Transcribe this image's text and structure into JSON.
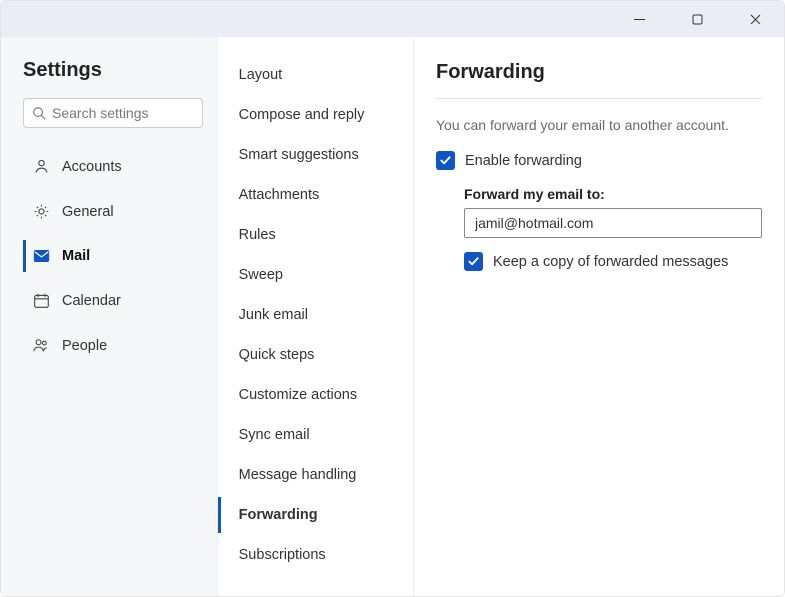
{
  "titlebar": {},
  "settings": {
    "title": "Settings",
    "search_placeholder": "Search settings",
    "nav": {
      "accounts": "Accounts",
      "general": "General",
      "mail": "Mail",
      "calendar": "Calendar",
      "people": "People"
    }
  },
  "subnav": {
    "layout": "Layout",
    "compose": "Compose and reply",
    "smart": "Smart suggestions",
    "attachments": "Attachments",
    "rules": "Rules",
    "sweep": "Sweep",
    "junk": "Junk email",
    "quick": "Quick steps",
    "customize": "Customize actions",
    "sync": "Sync email",
    "message": "Message handling",
    "forwarding": "Forwarding",
    "subs": "Subscriptions"
  },
  "forwarding": {
    "title": "Forwarding",
    "desc": "You can forward your email to another account.",
    "enable_label": "Enable forwarding",
    "forward_to_label": "Forward my email to:",
    "forward_to_value": "jamil@hotmail.com",
    "keep_copy_label": "Keep a copy of forwarded messages"
  }
}
